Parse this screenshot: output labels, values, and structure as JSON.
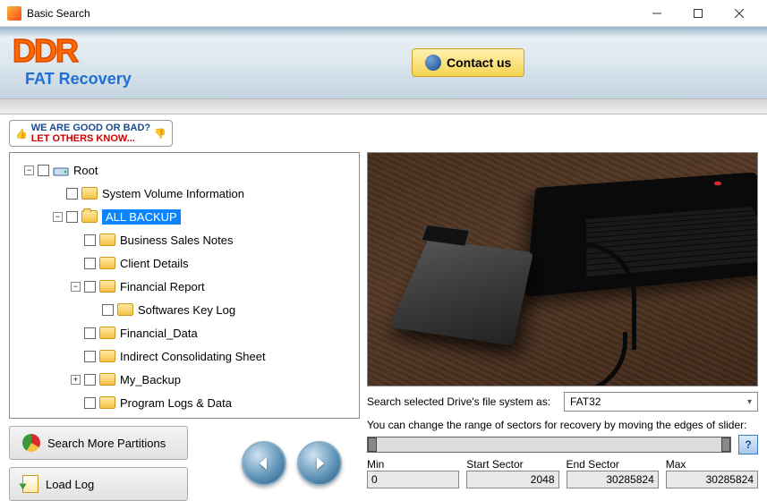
{
  "window": {
    "title": "Basic Search"
  },
  "banner": {
    "logo": "DDR",
    "subtitle": "FAT Recovery",
    "contact_label": "Contact us"
  },
  "feedback": {
    "line1": "WE ARE GOOD OR BAD?",
    "line2": "LET OTHERS KNOW..."
  },
  "tree": {
    "root": "Root",
    "items": [
      "System Volume Information",
      "ALL BACKUP",
      "Business Sales Notes",
      "Client Details",
      "Financial Report",
      "Softwares Key Log",
      "Financial_Data",
      "Indirect Consolidating Sheet",
      "My_Backup",
      "Program Logs & Data"
    ],
    "selected": "ALL BACKUP"
  },
  "buttons": {
    "search_more": "Search More Partitions",
    "load_log": "Load Log"
  },
  "fs": {
    "label": "Search selected Drive's file system as:",
    "value": "FAT32"
  },
  "slider": {
    "note": "You can change the range of sectors for recovery by moving the edges of slider:"
  },
  "sectors": {
    "min_label": "Min",
    "min_value": "0",
    "start_label": "Start Sector",
    "start_value": "2048",
    "end_label": "End Sector",
    "end_value": "30285824",
    "max_label": "Max",
    "max_value": "30285824"
  }
}
